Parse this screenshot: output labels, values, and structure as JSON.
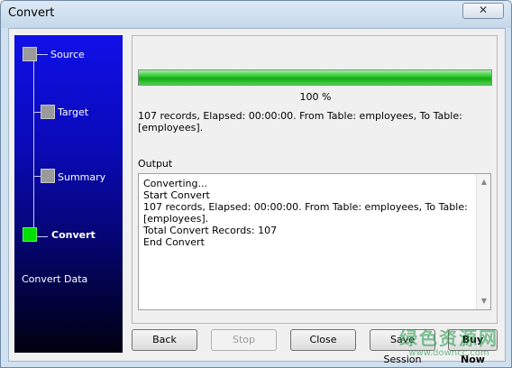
{
  "window": {
    "title": "Convert",
    "close_symbol": "✕"
  },
  "steps": [
    {
      "label": "Source",
      "active": false
    },
    {
      "label": "Target",
      "active": false
    },
    {
      "label": "Summary",
      "active": false
    },
    {
      "label": "Convert",
      "active": true
    }
  ],
  "side": {
    "section_label": "Convert Data"
  },
  "progress": {
    "value": 1.0,
    "percent_text": "100 %"
  },
  "status": {
    "line": "107 records,    Elapsed: 00:00:00.    From Table: employees,    To Table: [employees]."
  },
  "output": {
    "label": "Output",
    "lines": [
      "Converting...",
      "Start Convert",
      "107 records,    Elapsed: 00:00:00.    From Table: employees,    To Table: [employees].",
      "Total Convert Records: 107",
      "End Convert"
    ]
  },
  "buttons": {
    "back": "Back",
    "stop": "Stop",
    "close": "Close",
    "save_session": "Save Session",
    "buy_now": "Buy Now"
  },
  "watermark": {
    "logo": "绿色资源网",
    "url": "www.downcc.com"
  },
  "colors": {
    "progress": "#1fb81f",
    "active_step": "#00e000",
    "inactive_step": "#9a9a9a",
    "side_top": "#1010e8"
  }
}
